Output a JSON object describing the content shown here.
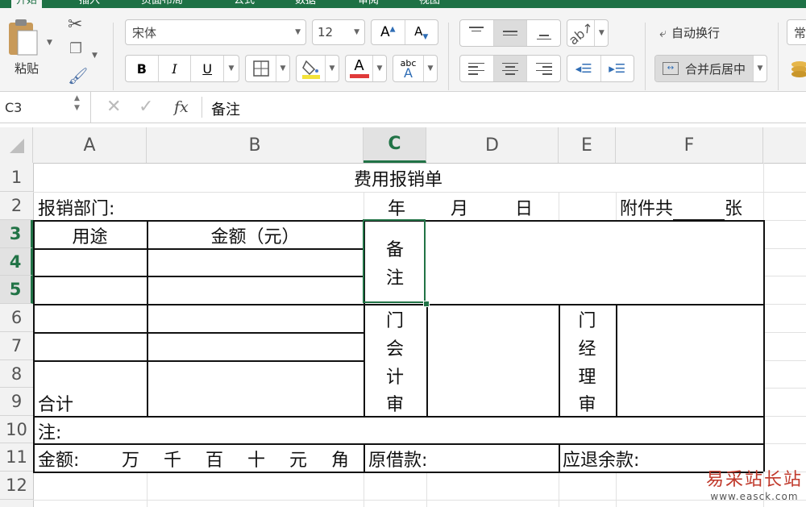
{
  "ribbon": {
    "tabs": [
      "开始",
      "插入",
      "页面布局",
      "公式",
      "数据",
      "审阅",
      "视图"
    ],
    "paste_label": "粘贴",
    "font_name": "宋体",
    "font_size": "12",
    "bold": "B",
    "italic": "I",
    "underline": "U",
    "font_color_glyph": "A",
    "phonetic_glyph": "abc",
    "wrap_text": "自动换行",
    "merge_center": "合并后居中",
    "number_format_partial": "常",
    "accent_color": "#1e7145",
    "highlight_color": "#f3e23a",
    "font_color": "#e03a3a"
  },
  "formula_bar": {
    "name_box": "C3",
    "fx": "fx",
    "content": "备注"
  },
  "grid": {
    "columns": [
      "A",
      "B",
      "C",
      "D",
      "E",
      "F"
    ],
    "rows": [
      "1",
      "2",
      "3",
      "4",
      "5",
      "6",
      "7",
      "8",
      "9",
      "10",
      "11",
      "12"
    ],
    "selected_cell": "C3"
  },
  "sheet": {
    "title": "费用报销单",
    "dept_label": "报销部门:",
    "year": "年",
    "month": "月",
    "day": "日",
    "attach_prefix": "附件共",
    "attach_suffix": "张",
    "col_usage": "用途",
    "col_amount": "金额（元）",
    "remark_1": "备",
    "remark_2": "注",
    "acct_chars": [
      "门",
      "会",
      "计",
      "审"
    ],
    "mgr_chars": [
      "门",
      "经",
      "理",
      "审"
    ],
    "total_label": "合计",
    "note_label": "注:",
    "amount_label": "金额:",
    "units": [
      "万",
      "千",
      "百",
      "十",
      "元",
      "角"
    ],
    "original_loan": "原借款:",
    "refund_remain": "应退余款:"
  },
  "watermark": {
    "text": "易采站长站",
    "url_text": "www.easck.com"
  }
}
